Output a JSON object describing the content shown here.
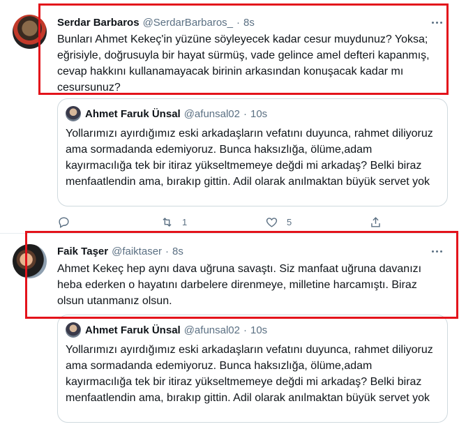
{
  "tweet1": {
    "name": "Serdar Barbaros",
    "handle": "@SerdarBarbaros_",
    "separator": "·",
    "time": "8s",
    "text": "Bunları Ahmet Kekeç'in yüzüne söyleyecek kadar cesur muydunuz? Yoksa; eğrisiyle, doğrusuyla bir hayat sürmüş, vade gelince amel defteri kapanmış, cevap hakkını kullanamayacak birinin arkasından konuşacak kadar mı cesursunuz?",
    "quote": {
      "name": "Ahmet Faruk Ünsal",
      "handle": "@afunsal02",
      "separator": "·",
      "time": "10s",
      "text": "Yollarımızı ayırdığımız eski arkadaşların vefatını duyunca, rahmet diliyoruz ama sormadanda edemiyoruz. Bunca haksızlığa, ölüme,adam kayırmacılığa tek bir itiraz yükseltmemeye değdi mi arkadaş? Belki biraz menfaatlendin ama, bırakıp gittin. Adil olarak anılmaktan büyük servet yok"
    },
    "actions": {
      "reply_icon": "reply-icon",
      "retweet_icon": "retweet-icon",
      "retweet_count": "1",
      "like_icon": "heart-icon",
      "like_count": "5",
      "share_icon": "share-icon"
    }
  },
  "tweet2": {
    "name": "Faik Taşer",
    "handle": "@faiktaser",
    "separator": "·",
    "time": "8s",
    "text": "Ahmet Kekeç hep aynı dava uğruna savaştı. Siz manfaat uğruna davanızı heba ederken o hayatını darbelere direnmeye, milletine harcamıştı. Biraz olsun utanmanız olsun.",
    "quote": {
      "name": "Ahmet Faruk Ünsal",
      "handle": "@afunsal02",
      "separator": "·",
      "time": "10s",
      "text": "Yollarımızı ayırdığımız eski arkadaşların vefatını duyunca, rahmet diliyoruz ama sormadanda edemiyoruz. Bunca haksızlığa, ölüme,adam kayırmacılığa tek bir itiraz yükseltmemeye değdi mi arkadaş? Belki biraz menfaatlendin ama, bırakıp gittin. Adil olarak anılmaktan büyük servet yok"
    }
  },
  "colors": {
    "highlight": "#e3131b",
    "secondary_text": "#5b7083",
    "border": "#cfd9de"
  }
}
